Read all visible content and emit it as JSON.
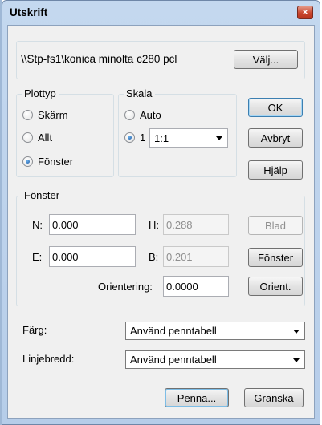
{
  "window": {
    "title": "Utskrift",
    "close_glyph": "×"
  },
  "printer": {
    "name": "\\\\Stp-fs1\\konica minolta c280 pcl",
    "choose_button": "Välj..."
  },
  "plot_type": {
    "label": "Plottyp",
    "options": [
      "Skärm",
      "Allt",
      "Fönster"
    ],
    "selected": "Fönster"
  },
  "scale": {
    "label": "Skala",
    "auto_label": "Auto",
    "manual_prefix": "1",
    "manual_value": "1:1",
    "selected": "manual"
  },
  "actions": {
    "ok": "OK",
    "cancel": "Avbryt",
    "help": "Hjälp"
  },
  "window_group": {
    "label": "Fönster",
    "n_label": "N:",
    "n_value": "0.000",
    "e_label": "E:",
    "e_value": "0.000",
    "h_label": "H:",
    "h_value": "0.288",
    "b_label": "B:",
    "b_value": "0.201",
    "orientation_label": "Orientering:",
    "orientation_value": "0.0000",
    "sheet_button": "Blad",
    "window_button": "Fönster",
    "orient_button": "Orient."
  },
  "color": {
    "label": "Färg:",
    "value": "Använd penntabell"
  },
  "line_width": {
    "label": "Linjebredd:",
    "value": "Använd penntabell"
  },
  "bottom": {
    "pen_button": "Penna...",
    "preview_button": "Granska"
  }
}
